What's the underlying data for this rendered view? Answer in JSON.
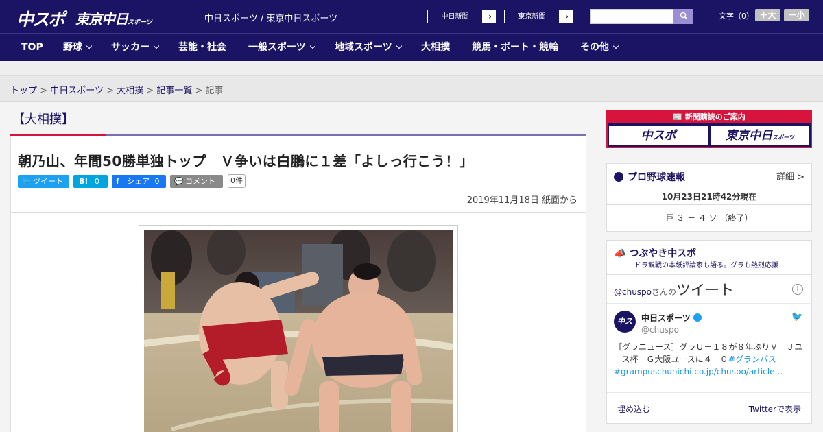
{
  "header": {
    "logo_chuspo": "中スポ",
    "logo_tokyo": "東京中日",
    "logo_tokyo_small": "スポーツ",
    "site_title": "中日スポーツ / 東京中日スポーツ",
    "paper_links": [
      "中日新聞",
      "東京新聞"
    ],
    "search_placeholder": "",
    "font_size_label": "文字（0）",
    "font_increase": "＋大",
    "font_decrease": "－小"
  },
  "nav": {
    "items": [
      {
        "label": "TOP",
        "dropdown": false
      },
      {
        "label": "野球",
        "dropdown": true
      },
      {
        "label": "サッカー",
        "dropdown": true
      },
      {
        "label": "芸能・社会",
        "dropdown": false
      },
      {
        "label": "一般スポーツ",
        "dropdown": true
      },
      {
        "label": "地域スポーツ",
        "dropdown": true
      },
      {
        "label": "大相撲",
        "dropdown": false
      },
      {
        "label": "競馬・ボート・競輪",
        "dropdown": false
      },
      {
        "label": "その他",
        "dropdown": true
      }
    ]
  },
  "breadcrumb": {
    "items": [
      "トップ",
      "中日スポーツ",
      "大相撲",
      "記事一覧"
    ],
    "current": "記事",
    "separator": ">"
  },
  "category": "【大相撲】",
  "article": {
    "headline": "朝乃山、年間50勝単独トップ　Ｖ争いは白鵬に１差「よしっ行こう！」",
    "share": {
      "tweet": "ツイート",
      "hatena_label": "B!",
      "hatena_count": "0",
      "facebook": "シェア",
      "facebook_count": "0",
      "comment": "コメント",
      "comment_count": "0件"
    },
    "date": "2019年11月18日 紙面から"
  },
  "sidebar": {
    "ad": {
      "title": "新聞購読のご案内",
      "logo_chuspo": "中スポ",
      "logo_tokyo": "東京中日",
      "logo_tokyo_small": "スポーツ"
    },
    "baseball": {
      "title": "プロ野球速報",
      "more": "詳細 >",
      "updated": "10月23日21時42分現在",
      "score": "巨 ３ － ４ ソ （終了）"
    },
    "tsubuyaki": {
      "title": "つぶやき中スポ",
      "subtitle": "ドラ観戦の本紙評論家も語る。グラも熱烈応援",
      "tweets_user": "@chuspo",
      "tweets_suffix": "さんの",
      "tweets_label": "ツイート",
      "account_name": "中日スポーツ",
      "account_handle": "@chuspo",
      "avatar_text": "中スポ",
      "tweet_text": "［グラニュース］グラＵ－１８が８年ぶりＶ　Ｊユース杯　Ｇ大阪ユースに４－０",
      "tweet_hashtag": "#グランパス",
      "tweet_link": "#grampuschunichi.co.jp/chuspo/article…",
      "embed": "埋め込む",
      "view_on_twitter": "Twitterで表示"
    }
  },
  "colors": {
    "brand_navy": "#1b1464",
    "accent_red": "#d6143c",
    "twitter": "#1da1f2",
    "hatena": "#00a4de",
    "facebook": "#1877f2",
    "comment_grey": "#8a8a8a"
  }
}
